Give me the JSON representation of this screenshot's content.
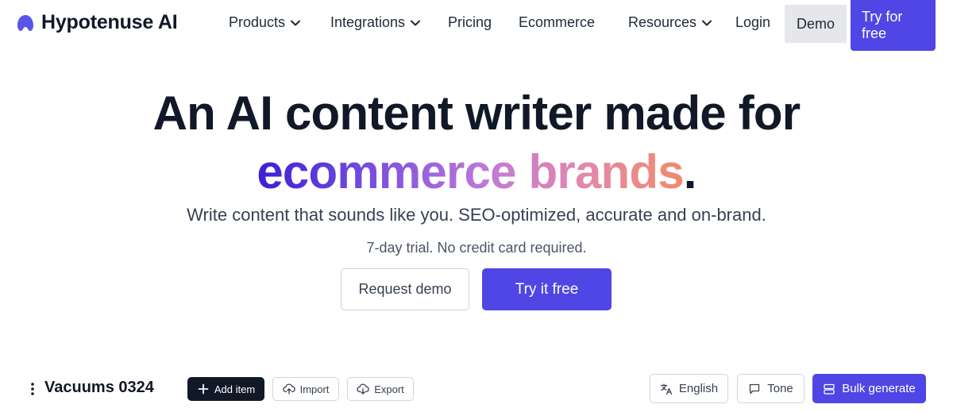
{
  "nav": {
    "logo_text": "Hypotenuse AI",
    "items": [
      {
        "label": "Products",
        "has_dropdown": true
      },
      {
        "label": "Integrations",
        "has_dropdown": true
      },
      {
        "label": "Pricing",
        "has_dropdown": false
      },
      {
        "label": "Ecommerce",
        "has_dropdown": false
      },
      {
        "label": "Resources",
        "has_dropdown": true
      },
      {
        "label": "Login",
        "has_dropdown": false
      }
    ],
    "demo_label": "Demo",
    "try_label": "Try for free"
  },
  "hero": {
    "headline_line1": "An AI content writer made for",
    "headline_highlight": "ecommerce brands",
    "headline_period": ".",
    "subheadline": "Write content that sounds like you. SEO-optimized, accurate and on-brand.",
    "note": "7-day trial. No credit card required.",
    "request_demo_label": "Request demo",
    "try_free_label": "Try it free"
  },
  "toolbar": {
    "title": "Vacuums 0324",
    "add_item_label": "Add item",
    "import_label": "Import",
    "export_label": "Export",
    "language_label": "English",
    "tone_label": "Tone",
    "bulk_generate_label": "Bulk generate"
  },
  "colors": {
    "primary": "#4f46e5",
    "dark": "#111827",
    "gradient_start": "#3b1fd6",
    "gradient_end": "#f08a6c"
  },
  "icons": {
    "logo": "hypotenuse-logo-icon",
    "dropdown": "chevron-down-icon",
    "menu": "kebab-menu-icon",
    "add": "plus-icon",
    "import": "cloud-upload-icon",
    "export": "cloud-download-icon",
    "language": "translate-icon",
    "tone": "chat-bubble-icon",
    "bulk": "stack-icon"
  }
}
